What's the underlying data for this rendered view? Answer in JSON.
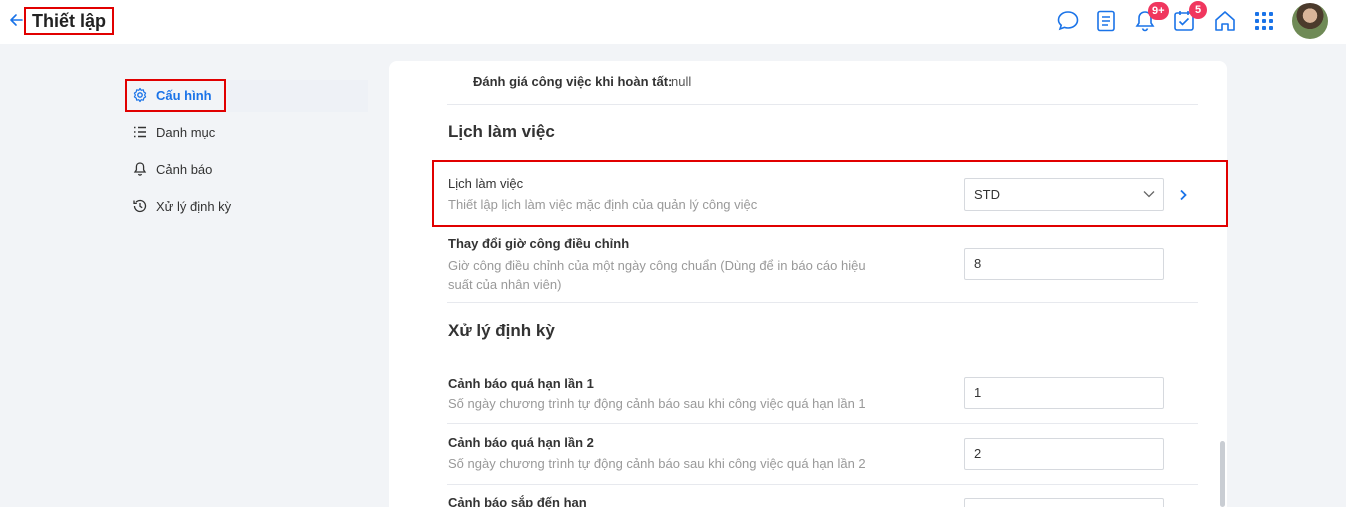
{
  "header": {
    "title": "Thiết lập",
    "icons": [
      "back-arrow-icon",
      "chat-icon",
      "task-list-icon",
      "bell-icon",
      "calendar-check-icon",
      "home-icon",
      "apps-grid-icon"
    ],
    "notification_badge": "9+",
    "task_badge": "5",
    "accent_color": "#1a73e8",
    "badge_color": "#f0365e"
  },
  "sidebar": {
    "items": [
      {
        "label": "Cấu hình",
        "icon": "gear-icon",
        "active": true
      },
      {
        "label": "Danh mục",
        "icon": "list-icon",
        "active": false
      },
      {
        "label": "Cảnh báo",
        "icon": "bell-icon",
        "active": false
      },
      {
        "label": "Xử lý định kỳ",
        "icon": "history-icon",
        "active": false
      }
    ]
  },
  "main": {
    "top_row": {
      "label": "Đánh giá công việc khi hoàn tất:",
      "value": "null"
    },
    "section_schedule": {
      "title": "Lịch làm việc",
      "rows": [
        {
          "label": "Lịch làm việc",
          "description": "Thiết lập lịch làm việc mặc định của quản lý công việc",
          "value": "STD"
        },
        {
          "label": "Thay đổi giờ công điều chỉnh",
          "description": "Giờ công điều chỉnh của một ngày công chuẩn (Dùng để in báo cáo hiệu suất của nhân viên)",
          "value": "8"
        }
      ]
    },
    "section_periodic": {
      "title": "Xử lý định kỳ",
      "rows": [
        {
          "label": "Cảnh báo quá hạn lần 1",
          "description": "Số ngày chương trình tự động cảnh báo sau khi công việc quá hạn lần 1",
          "value": "1"
        },
        {
          "label": "Cảnh báo quá hạn lần 2",
          "description": "Số ngày chương trình tự động cảnh báo sau khi công việc quá hạn lần 2",
          "value": "2"
        },
        {
          "label": "Cảnh báo sắp đến hạn",
          "description": "",
          "value": ""
        }
      ]
    }
  }
}
